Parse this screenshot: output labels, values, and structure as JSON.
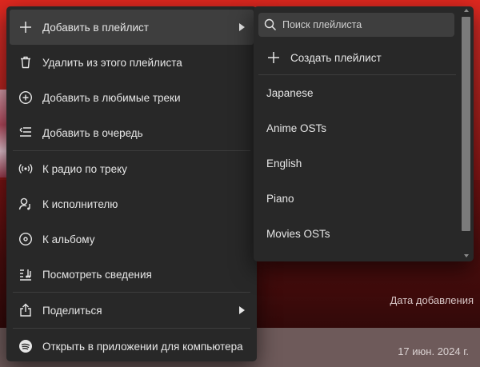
{
  "menu": {
    "add_to_playlist": "Добавить в плейлист",
    "remove_from_playlist": "Удалить из этого плейлиста",
    "add_to_liked": "Добавить в любимые треки",
    "add_to_queue": "Добавить в очередь",
    "track_radio": "К радио по треку",
    "go_to_artist": "К исполнителю",
    "go_to_album": "К альбому",
    "view_credits": "Посмотреть сведения",
    "share": "Поделиться",
    "open_in_desktop": "Открыть в приложении для компьютера"
  },
  "submenu": {
    "search_placeholder": "Поиск плейлиста",
    "create_playlist": "Создать плейлист",
    "playlists": [
      "Japanese",
      "Anime OSTs",
      "English",
      "Piano",
      "Movies OSTs"
    ]
  },
  "background": {
    "date_added_header": "Дата добавления",
    "row_date": "17 июн. 2024 г."
  },
  "icons": {
    "add_to_playlist": "plus-icon",
    "remove": "trash-icon",
    "liked": "plus-circle-icon",
    "queue": "queue-icon",
    "radio": "radio-icon",
    "artist": "artist-icon",
    "album": "album-icon",
    "credits": "credits-icon",
    "share": "share-icon",
    "desktop": "spotify-icon",
    "search": "search-icon"
  },
  "colors": {
    "menu_bg": "#282828",
    "active_item": "#3e3e3e",
    "text": "#e6e6e6"
  }
}
